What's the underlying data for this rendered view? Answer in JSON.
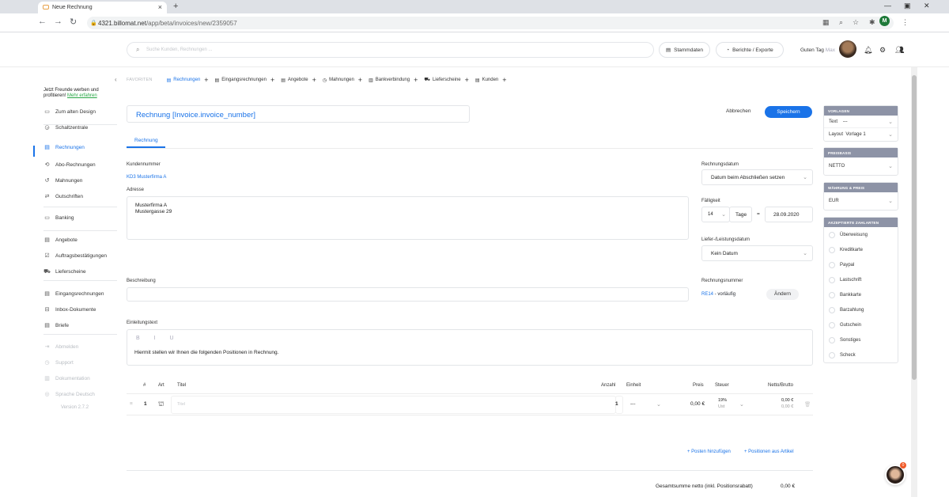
{
  "browser": {
    "tab_title": "Neue Rechnung",
    "tab_close": "×",
    "new_tab": "+",
    "url_host": "4321.billomat.net",
    "url_path": "/app/beta/invoices/new/2359057",
    "profile_initial": "M"
  },
  "header": {
    "search_placeholder": "Suche Kunden, Rechnungen ...",
    "stammdaten": "Stammdaten",
    "berichte": "Berichte / Exporte",
    "greeting": "Guten Tag",
    "user_name": "Max"
  },
  "sidebar": {
    "promo_text": "Jetzt Freunde werben und profitieren!",
    "promo_link": "Mehr erfahren",
    "items": [
      {
        "label": "Zum alten Design",
        "icon": "▭"
      },
      {
        "label": "Schaltzentrale",
        "icon": "◶"
      },
      {
        "label": "Rechnungen",
        "icon": "▤"
      },
      {
        "label": "Abo-Rechnungen",
        "icon": "⟲"
      },
      {
        "label": "Mahnungen",
        "icon": "↺"
      },
      {
        "label": "Gutschriften",
        "icon": "⇄"
      },
      {
        "label": "Banking",
        "icon": "▭"
      },
      {
        "label": "Angebote",
        "icon": "▤"
      },
      {
        "label": "Auftragsbestätigungen",
        "icon": "☑"
      },
      {
        "label": "Lieferscheine",
        "icon": "⛟"
      },
      {
        "label": "Eingangsrechnungen",
        "icon": "▤"
      },
      {
        "label": "Inbox-Dokumente",
        "icon": "⊟"
      },
      {
        "label": "Briefe",
        "icon": "▤"
      },
      {
        "label": "Abmelden",
        "icon": "⇥"
      },
      {
        "label": "Support",
        "icon": "◷"
      },
      {
        "label": "Dokumentation",
        "icon": "▥"
      },
      {
        "label": "Sprache Deutsch",
        "icon": "◎"
      }
    ],
    "version": "Version 2.7.2"
  },
  "favorites": {
    "label": "FAVORITEN",
    "items": [
      "Rechnungen",
      "Eingangsrechnungen",
      "Angebote",
      "Mahnungen",
      "Bankverbindung",
      "Lieferscheine",
      "Kunden"
    ]
  },
  "form": {
    "title": "Rechnung [Invoice.invoice_number]",
    "cancel": "Abbrechen",
    "save": "Speichern",
    "tab": "Rechnung",
    "customer_number_label": "Kundennummer",
    "customer_number": "KD3 Musterfirma A",
    "address_label": "Adresse",
    "address_line1": "Musterfirma A",
    "address_line2": "Mustergasse 29",
    "invoice_date_label": "Rechnungsdatum",
    "invoice_date_value": "Datum beim Abschließen setzen",
    "due_label": "Fälligkeit",
    "due_days": "14",
    "due_unit": "Tage",
    "due_eq": "=",
    "due_date": "28.09.2020",
    "delivery_label": "Liefer-/Leistungsdatum",
    "delivery_value": "Kein Datum",
    "description_label": "Beschreibung",
    "invoice_number_label": "Rechnungsnummer",
    "invoice_number_code": "RE14",
    "invoice_number_status": " - vorläufig",
    "change_button": "Ändern",
    "intro_label": "Einleitungstext",
    "editor_tools": "B I U",
    "intro_text": "Hiermit stellen wir Ihnen die folgenden Positionen in Rechnung."
  },
  "positions": {
    "headers": {
      "num": "#",
      "art": "Art",
      "title": "Titel",
      "qty": "Anzahl",
      "unit": "Einheit",
      "price": "Preis",
      "tax": "Steuer",
      "net_gross": "Netto/Brutto"
    },
    "row": {
      "num": "1",
      "title_placeholder": "Titel",
      "qty": "1",
      "unit": "---",
      "price": "0,00 €",
      "tax_rate": "19%",
      "tax_name": "Ust",
      "net": "0,00 €",
      "gross": "0,00 €"
    },
    "add_position": "+ Posten hinzufügen",
    "add_from_article": "+ Positionen aus Artikel",
    "total_label": "Gesamtsumme netto (inkl. Positionsrabatt)",
    "total_value": "0,00 €"
  },
  "right_panels": {
    "vorlagen_head": "VORLAGEN",
    "text_label": "Text",
    "text_value": "---",
    "layout_label": "Layout",
    "layout_value": "Vorlage 1",
    "preisbasis_head": "PREISBASIS",
    "preisbasis_value": "NETTO",
    "waehrung_head": "WÄHRUNG & PREIS",
    "waehrung_value": "EUR",
    "zahlarten_head": "AKZEPTIERTE ZAHLARTEN",
    "payment_methods": [
      "Überweisung",
      "Kreditkarte",
      "Paypal",
      "Lastschrift",
      "Bankkarte",
      "Barzahlung",
      "Gutschein",
      "Sonstiges",
      "Scheck"
    ]
  },
  "colors": {
    "accent": "#1a73e8",
    "panel_head": "#8d93a6",
    "promo_link": "#28a745"
  }
}
